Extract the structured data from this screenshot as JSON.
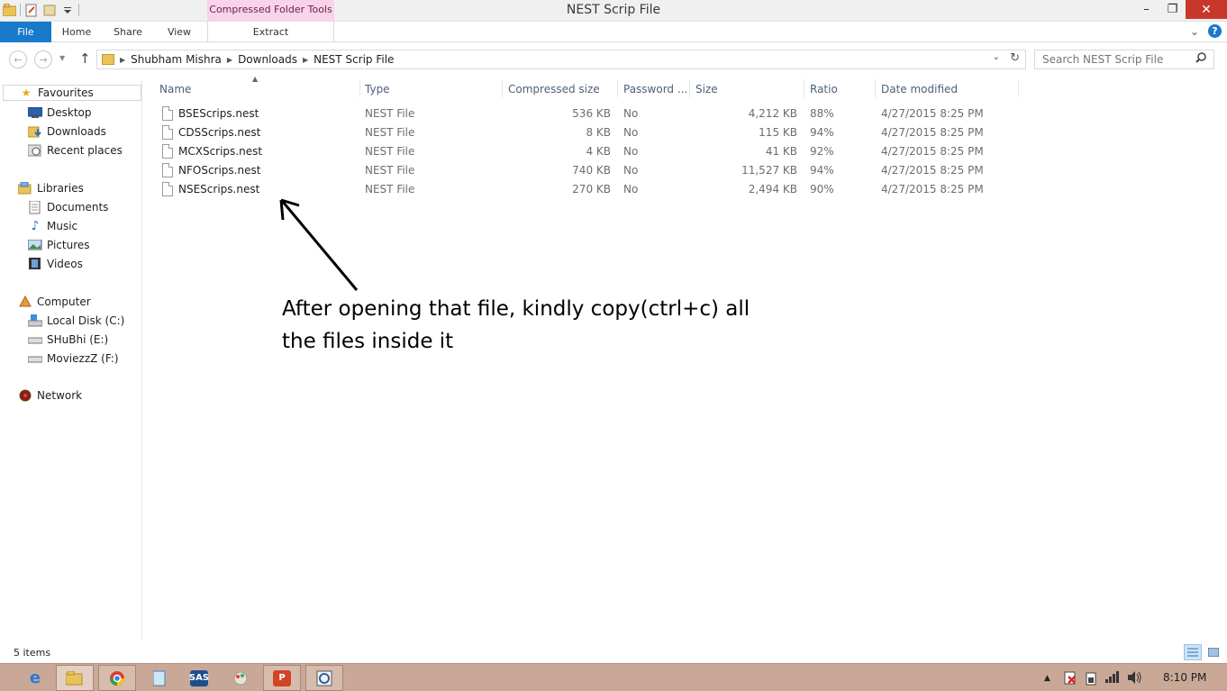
{
  "window": {
    "title": "NEST Scrip File",
    "context_tab_header": "Compressed Folder Tools",
    "controls": {
      "minimize": "–",
      "restore": "❐",
      "close": "✕"
    }
  },
  "ribbon": {
    "tabs": [
      "File",
      "Home",
      "Share",
      "View",
      "Extract"
    ],
    "expand_glyph": "⌄",
    "help_glyph": "?"
  },
  "address": {
    "breadcrumbs": [
      "Shubham Mishra",
      "Downloads",
      "NEST Scrip File"
    ],
    "search_placeholder": "Search NEST Scrip File",
    "refresh_glyph": "↻",
    "dropdown_glyph": "⌄",
    "back_glyph": "←",
    "forward_glyph": "→",
    "up_glyph": "↑"
  },
  "navigation": {
    "favourites": {
      "label": "Favourites",
      "items": [
        "Desktop",
        "Downloads",
        "Recent places"
      ]
    },
    "libraries": {
      "label": "Libraries",
      "items": [
        "Documents",
        "Music",
        "Pictures",
        "Videos"
      ]
    },
    "computer": {
      "label": "Computer",
      "items": [
        "Local Disk (C:)",
        "SHuBhi (E:)",
        "MoviezzZ (F:)"
      ]
    },
    "network": {
      "label": "Network"
    }
  },
  "columns": [
    "Name",
    "Type",
    "Compressed size",
    "Password ...",
    "Size",
    "Ratio",
    "Date modified"
  ],
  "files": [
    {
      "name": "BSEScrips.nest",
      "type": "NEST File",
      "compressed": "536 KB",
      "password": "No",
      "size": "4,212 KB",
      "ratio": "88%",
      "modified": "4/27/2015 8:25 PM"
    },
    {
      "name": "CDSScrips.nest",
      "type": "NEST File",
      "compressed": "8 KB",
      "password": "No",
      "size": "115 KB",
      "ratio": "94%",
      "modified": "4/27/2015 8:25 PM"
    },
    {
      "name": "MCXScrips.nest",
      "type": "NEST File",
      "compressed": "4 KB",
      "password": "No",
      "size": "41 KB",
      "ratio": "92%",
      "modified": "4/27/2015 8:25 PM"
    },
    {
      "name": "NFOScrips.nest",
      "type": "NEST File",
      "compressed": "740 KB",
      "password": "No",
      "size": "11,527 KB",
      "ratio": "94%",
      "modified": "4/27/2015 8:25 PM"
    },
    {
      "name": "NSEScrips.nest",
      "type": "NEST File",
      "compressed": "270 KB",
      "password": "No",
      "size": "2,494 KB",
      "ratio": "90%",
      "modified": "4/27/2015 8:25 PM"
    }
  ],
  "annotation": {
    "line1": "After opening that file, kindly copy(ctrl+c) all",
    "line2": "the files inside it"
  },
  "status": {
    "item_count": "5 items"
  },
  "taskbar": {
    "apps": [
      "ie-icon",
      "file-explorer-icon",
      "chrome-icon",
      "notepad-icon",
      "sas-icon",
      "paint-icon",
      "powerpoint-icon",
      "remote-icon"
    ],
    "sas_label": "SAS",
    "ppt_label": "P",
    "clock": "8:10 PM"
  },
  "colors": {
    "accent": "#1979ca",
    "context_tab": "#f9d4e9",
    "taskbar": "#c9a898",
    "close": "#c7382b"
  }
}
